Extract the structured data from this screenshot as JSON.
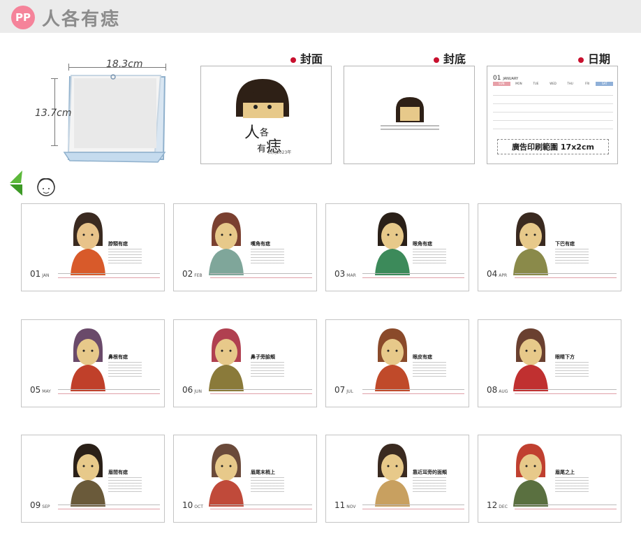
{
  "header": {
    "logo": "PP",
    "title": "人各有痣"
  },
  "product": {
    "width_label": "18.3cm",
    "height_label": "13.7cm"
  },
  "labels": {
    "cover": "封面",
    "back": "封底",
    "dates": "日期"
  },
  "cover": {
    "title_chars": [
      "人",
      "各",
      "有",
      "痣"
    ],
    "year": "西元2023年"
  },
  "date_panel": {
    "month_num": "01",
    "month_name": "JANUARY",
    "weekdays": [
      "SUN",
      "MON",
      "TUE",
      "WED",
      "THU",
      "FRI",
      "SAT"
    ],
    "print_range": "廣告印刷範圍 17x2cm"
  },
  "months": [
    {
      "num": "01",
      "abbr": "JAN",
      "title": "脖頸有痣"
    },
    {
      "num": "02",
      "abbr": "FEB",
      "title": "嘴角有痣"
    },
    {
      "num": "03",
      "abbr": "MAR",
      "title": "眼角有痣"
    },
    {
      "num": "04",
      "abbr": "APR",
      "title": "下巴有痣"
    },
    {
      "num": "05",
      "abbr": "MAY",
      "title": "鼻根有痣"
    },
    {
      "num": "06",
      "abbr": "JUN",
      "title": "鼻子旁臉頰"
    },
    {
      "num": "07",
      "abbr": "JUL",
      "title": "眼皮有痣"
    },
    {
      "num": "08",
      "abbr": "AUG",
      "title": "眼睛下方"
    },
    {
      "num": "09",
      "abbr": "SEP",
      "title": "眉間有痣"
    },
    {
      "num": "10",
      "abbr": "OCT",
      "title": "眉尾末梢上"
    },
    {
      "num": "11",
      "abbr": "NOV",
      "title": "靠近耳旁的面頰"
    },
    {
      "num": "12",
      "abbr": "DEC",
      "title": "眉尾之上"
    }
  ],
  "colors": {
    "accent_red": "#c8102e",
    "logo_pink": "#f5839a",
    "header_gray": "#ebebeb"
  }
}
